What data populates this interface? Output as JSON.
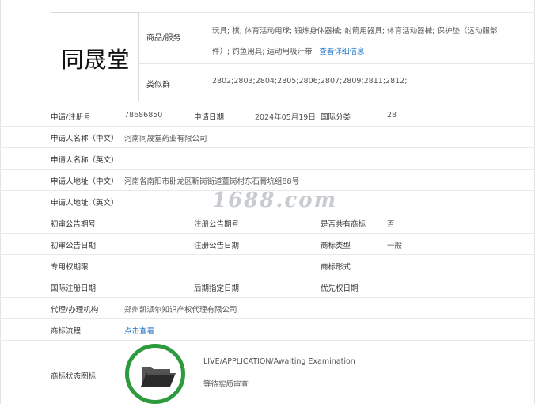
{
  "logo": {
    "text": "同晟堂"
  },
  "top": {
    "goods_label": "商品/服务",
    "goods_line1": "玩具; 棋; 体育活动用球; 锻炼身体器械; 射箭用器具; 体育活动器械; 保护垫（运动服部",
    "goods_line2": "件）; 钓鱼用具; 运动用吸汗带",
    "more_link": "查看详细信息",
    "similar_label": "类似群",
    "similar_value": "2802;2803;2804;2805;2806;2807;2809;2811;2812;"
  },
  "rows": {
    "r1": {
      "a_label": "申请/注册号",
      "a_value": "78686850",
      "b_label": "申请日期",
      "b_value": "2024年05月19日",
      "c_label": "国际分类",
      "c_value": "28"
    },
    "r2": {
      "label": "申请人名称（中文）",
      "value": "河南同晟堂药业有限公司"
    },
    "r3": {
      "label": "申请人名称（英文）",
      "value": ""
    },
    "r4": {
      "label": "申请人地址（中文）",
      "value": "河南省南阳市卧龙区靳岗街道董岗村东石膏坑组88号"
    },
    "r5": {
      "label": "申请人地址（英文）",
      "value": ""
    },
    "r6": {
      "a_label": "初审公告期号",
      "b_label": "注册公告期号",
      "c_label": "是否共有商标",
      "c_value": "否"
    },
    "r7": {
      "a_label": "初审公告日期",
      "b_label": "注册公告日期",
      "c_label": "商标类型",
      "c_value": "一般"
    },
    "r8": {
      "a_label": "专用权期限",
      "c_label": "商标形式"
    },
    "r9": {
      "a_label": "国际注册日期",
      "b_label": "后期指定日期",
      "c_label": "优先权日期"
    },
    "r10": {
      "label": "代理/办理机构",
      "value": "郑州凯派尔知识产权代理有限公司"
    },
    "r11": {
      "label": "商标流程",
      "link": "点击查看"
    }
  },
  "status": {
    "label": "商标状态图标",
    "english": "LIVE/APPLICATION/Awaiting Examination",
    "chinese": "等待实质审查",
    "ring_color": "#2e9a3e"
  },
  "watermark": {
    "site": "1688.com"
  }
}
